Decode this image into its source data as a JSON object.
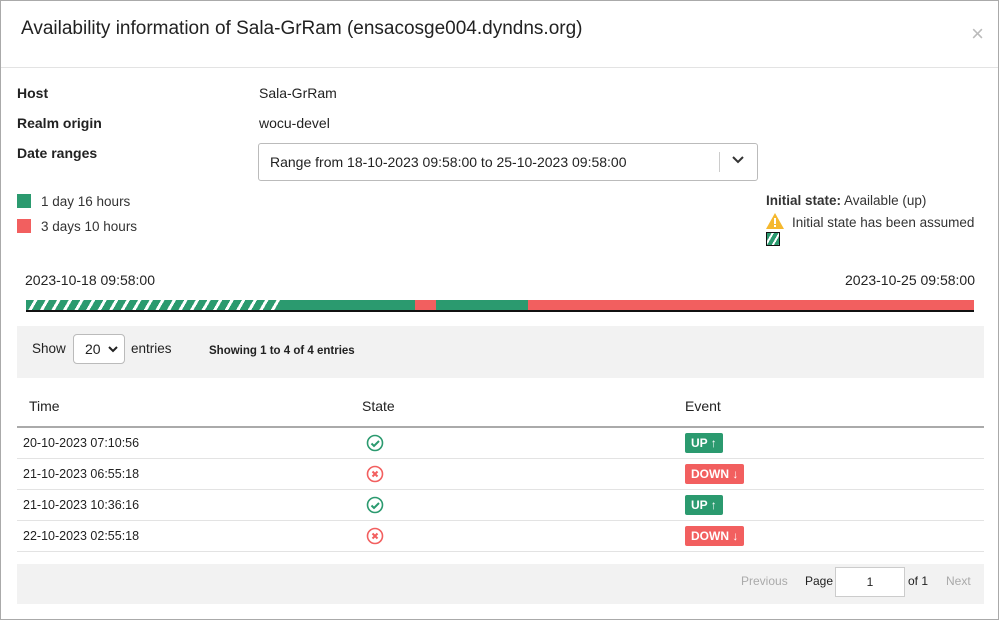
{
  "title": "Availability information of Sala-GrRam (ensacosge004.dyndns.org)",
  "close_icon": "×",
  "fields": {
    "host_label": "Host",
    "host": "Sala-GrRam",
    "realm_label": "Realm origin",
    "realm": "wocu-devel",
    "date_label": "Date ranges",
    "date_value": "Range from 18-10-2023 09:58:00 to 25-10-2023 09:58:00"
  },
  "legend": [
    {
      "label": "1 day 16 hours",
      "color": "#2b9a6f"
    },
    {
      "label": "3 days 10 hours",
      "color": "#f25f5f"
    }
  ],
  "initial": {
    "label": "Initial state:",
    "value": "Available (up)",
    "assumed": "Initial state has been assumed"
  },
  "timeline": {
    "start": "2023-10-18 09:58:00",
    "end": "2023-10-25 09:58:00"
  },
  "toolbar": {
    "show": "Show",
    "entries_value": "20",
    "entries": "entries",
    "info": "Showing 1 to 4 of 4 entries"
  },
  "table": {
    "headers": [
      "Time",
      "State",
      "Event"
    ],
    "rows": [
      {
        "time": "20-10-2023 07:10:56",
        "state": "up",
        "event": "UP ↑"
      },
      {
        "time": "21-10-2023 06:55:18",
        "state": "down",
        "event": "DOWN ↓"
      },
      {
        "time": "21-10-2023 10:36:16",
        "state": "up",
        "event": "UP ↑"
      },
      {
        "time": "22-10-2023 02:55:18",
        "state": "down",
        "event": "DOWN ↓"
      }
    ]
  },
  "pagination": {
    "previous": "Previous",
    "page": "Page",
    "page_value": "1",
    "of": "of 1",
    "next": "Next"
  },
  "colors": {
    "up": "#2b9a6f",
    "down": "#f25f5f"
  }
}
